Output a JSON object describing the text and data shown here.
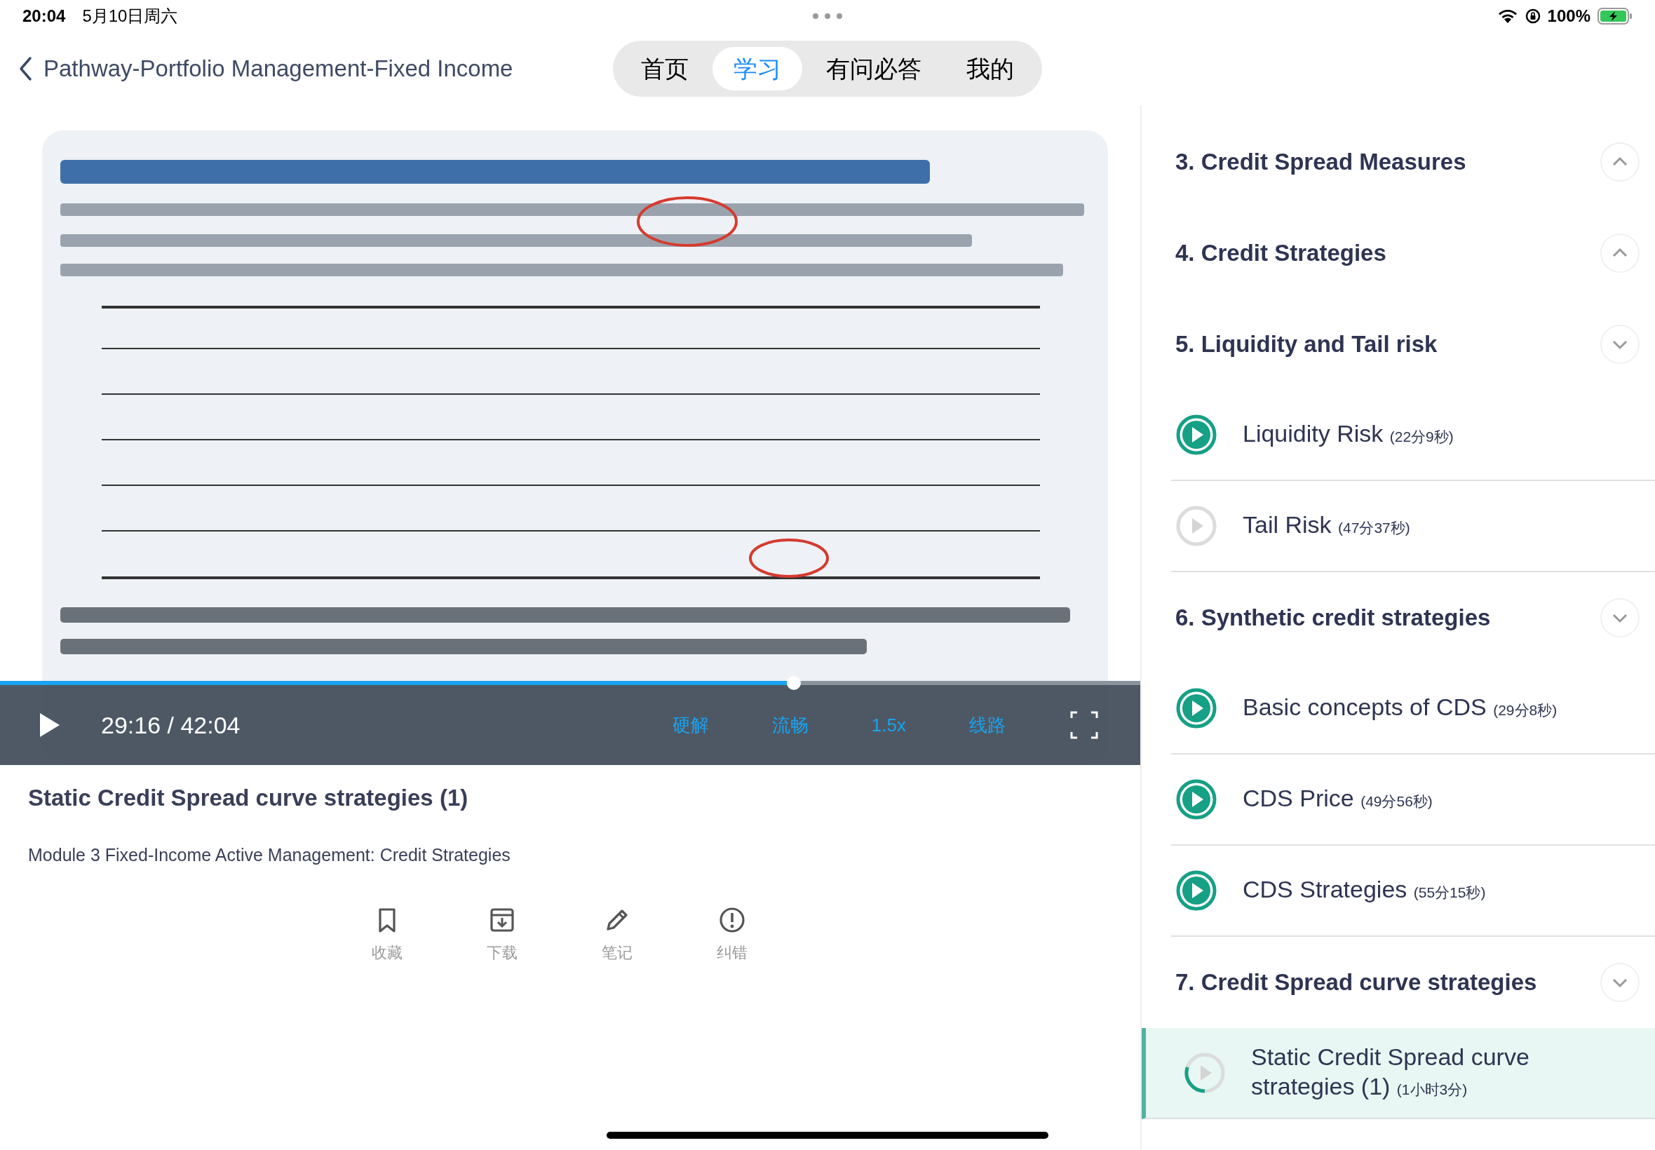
{
  "status_bar": {
    "time": "20:04",
    "date": "5月10日周六",
    "battery": "100%"
  },
  "nav": {
    "title": "Pathway-Portfolio Management-Fixed Income",
    "tabs": [
      {
        "label": "首页",
        "selected": false
      },
      {
        "label": "学习",
        "selected": true
      },
      {
        "label": "有问必答",
        "selected": false
      },
      {
        "label": "我的",
        "selected": false
      }
    ]
  },
  "player": {
    "playing": false,
    "time": "29:16 / 42:04",
    "level": 0.696,
    "options": [
      "硬解",
      "流畅",
      "1.5x",
      "线路"
    ]
  },
  "lesson": {
    "title": "Static Credit Spread curve strategies (1)",
    "module": "Module 3 Fixed-Income Active Management: Credit Strategies",
    "actions": [
      {
        "kind": "bookmark",
        "label": "收藏"
      },
      {
        "kind": "download",
        "label": "下载"
      },
      {
        "kind": "note",
        "label": "笔记"
      },
      {
        "kind": "report",
        "label": "纠错"
      }
    ]
  },
  "sections": [
    {
      "title": "3. Credit Spread Measures",
      "collapsed": true
    },
    {
      "title": "4. Credit Strategies",
      "collapsed": true
    },
    {
      "title": "5. Liquidity and Tail risk",
      "collapsed": false,
      "children": [
        {
          "title": "Liquidity Risk",
          "duration": "(22分9秒)",
          "watched": true,
          "selected": false
        },
        {
          "title": "Tail Risk",
          "duration": "(47分37秒)",
          "watched": false,
          "selected": false
        }
      ]
    },
    {
      "title": "6. Synthetic credit strategies",
      "collapsed": false,
      "children": [
        {
          "title": "Basic concepts of CDS",
          "duration": "(29分8秒)",
          "watched": true,
          "selected": false
        },
        {
          "title": "CDS Price",
          "duration": "(49分56秒)",
          "watched": true,
          "selected": false
        },
        {
          "title": "CDS Strategies",
          "duration": "(55分15秒)",
          "watched": true,
          "selected": false
        }
      ]
    },
    {
      "title": "7. Credit Spread curve strategies",
      "collapsed": false,
      "children": [
        {
          "title": "Static Credit Spread curve strategies (1)",
          "duration": "(1小时3分)",
          "level": 0.3,
          "selected": true
        }
      ]
    }
  ]
}
